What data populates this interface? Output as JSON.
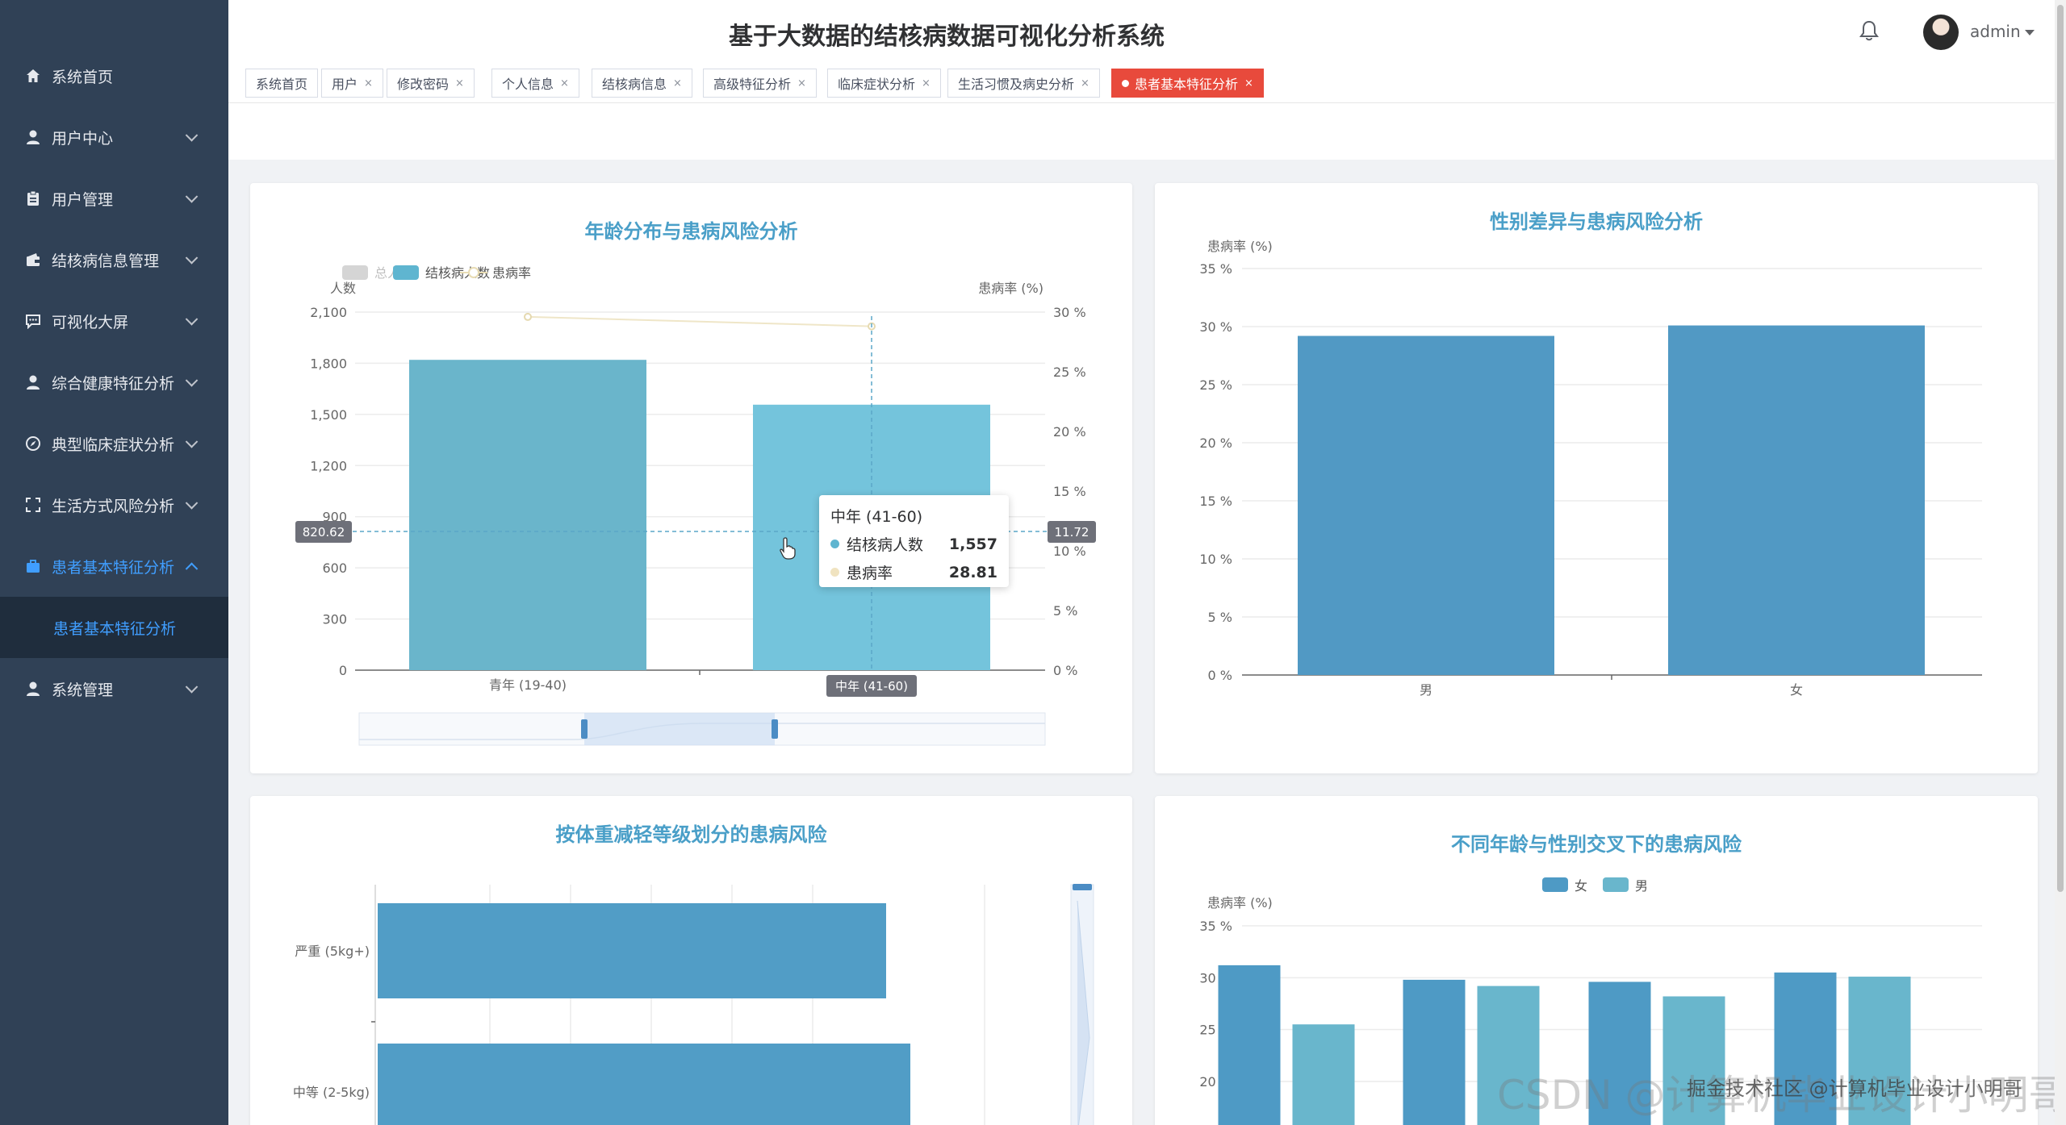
{
  "app": {
    "title": "基于大数据的结核病数据可视化分析系统",
    "user": "admin"
  },
  "sidebar": {
    "items": [
      {
        "label": "系统首页",
        "icon": "home-icon"
      },
      {
        "label": "用户中心",
        "icon": "user-icon"
      },
      {
        "label": "用户管理",
        "icon": "clipboard-icon"
      },
      {
        "label": "结核病信息管理",
        "icon": "wallet-icon"
      },
      {
        "label": "可视化大屏",
        "icon": "chat-icon"
      },
      {
        "label": "综合健康特征分析",
        "icon": "user-icon"
      },
      {
        "label": "典型临床症状分析",
        "icon": "compass-icon"
      },
      {
        "label": "生活方式风险分析",
        "icon": "fullscreen-icon"
      },
      {
        "label": "患者基本特征分析",
        "icon": "briefcase-icon"
      },
      {
        "label": "系统管理",
        "icon": "user-icon"
      }
    ],
    "submenu": {
      "label": "患者基本特征分析"
    }
  },
  "tags": [
    {
      "label": "系统首页"
    },
    {
      "label": "用户"
    },
    {
      "label": "修改密码"
    },
    {
      "label": "个人信息"
    },
    {
      "label": "结核病信息"
    },
    {
      "label": "高级特征分析"
    },
    {
      "label": "临床症状分析"
    },
    {
      "label": "生活习惯及病史分析"
    },
    {
      "label": "患者基本特征分析"
    }
  ],
  "tag_close": "×",
  "tooltip": {
    "title": "中年 (41-60)",
    "rows": [
      {
        "name": "结核病人数",
        "value": "1,557",
        "color": "#5fb5d0"
      },
      {
        "name": "患病率",
        "value": "28.81",
        "color": "#f0e3c0"
      }
    ]
  },
  "watermark": "CSDN @计算机毕业设计小明哥",
  "watermark_overlay": "掘金技术社区 @计算机毕业设计小明哥",
  "chart_data": [
    {
      "type": "bar",
      "title": "年龄分布与患病风险分析",
      "legend": [
        "总人数",
        "结核病人数",
        "患病率"
      ],
      "ylabel": "人数",
      "ylabel_right": "患病率 (%)",
      "categories": [
        "青年 (19-40)",
        "中年 (41-60)"
      ],
      "y_ticks": [
        "0",
        "300",
        "600",
        "900",
        "1,200",
        "1,500",
        "1,800",
        "2,100"
      ],
      "y_right_ticks": [
        "0 %",
        "5 %",
        "10 %",
        "15 %",
        "20 %",
        "25 %",
        "30 %"
      ],
      "ylim": [
        0,
        2100
      ],
      "ylim_right": [
        0,
        30
      ],
      "series": [
        {
          "name": "结核病人数",
          "values": [
            1820,
            1557
          ]
        },
        {
          "name": "患病率",
          "values": [
            29.6,
            28.81
          ]
        }
      ],
      "axis_pointer": {
        "left": "820.62",
        "right": "11.72",
        "category": "中年 (41-60)"
      },
      "colors": {
        "bar1": "#6ab5cb",
        "bar2": "#74c4dc",
        "line": "#f0e3c0"
      }
    },
    {
      "type": "bar",
      "title": "性别差异与患病风险分析",
      "ylabel": "患病率 (%)",
      "categories": [
        "男",
        "女"
      ],
      "y_ticks": [
        "0 %",
        "5 %",
        "10 %",
        "15 %",
        "20 %",
        "25 %",
        "30 %",
        "35 %"
      ],
      "ylim": [
        0,
        35
      ],
      "values": [
        29.2,
        30.1
      ],
      "colors": {
        "bar": "#5199c4"
      }
    },
    {
      "type": "bar",
      "title": "按体重减轻等级划分的患病风险",
      "orientation": "horizontal",
      "categories": [
        "严重 (5kg+)",
        "中等 (2-5kg)"
      ],
      "values": [
        0.84,
        0.88
      ],
      "colors": {
        "bar": "#519dc6"
      }
    },
    {
      "type": "bar",
      "title": "不同年龄与性别交叉下的患病风险",
      "ylabel": "患病率 (%)",
      "legend": [
        "女",
        "男"
      ],
      "y_ticks": [
        "20 %",
        "25 %",
        "30 %",
        "35 %"
      ],
      "ylim": [
        20,
        35
      ],
      "series": [
        {
          "name": "女",
          "values": [
            31.2,
            29.8,
            29.6,
            30.5
          ]
        },
        {
          "name": "男",
          "values": [
            25.5,
            29.2,
            28.2,
            30.1
          ]
        }
      ],
      "colors": {
        "女": "#4e9ac5",
        "男": "#69b6cc"
      }
    }
  ]
}
